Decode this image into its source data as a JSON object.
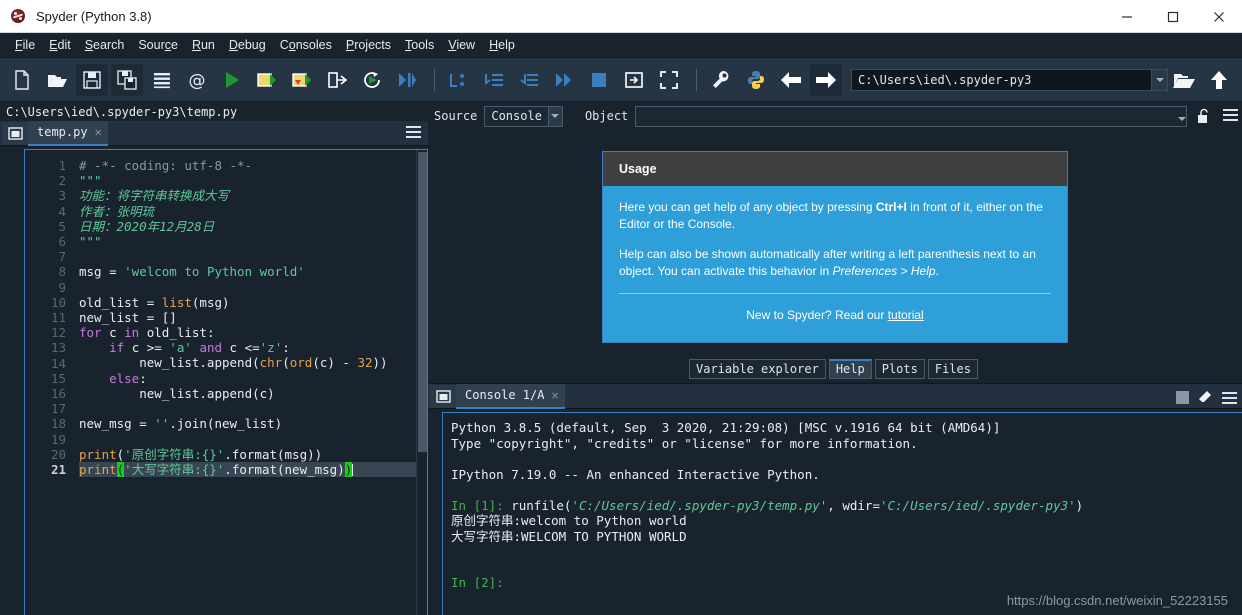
{
  "window": {
    "title": "Spyder (Python 3.8)",
    "app_icon": "spyder-logo-icon",
    "minimize": "–",
    "maximize": "□",
    "close": "✕"
  },
  "menubar": {
    "items": [
      {
        "label": "File",
        "accel": "F"
      },
      {
        "label": "Edit",
        "accel": "E"
      },
      {
        "label": "Search",
        "accel": "S"
      },
      {
        "label": "Source",
        "accel": "c"
      },
      {
        "label": "Run",
        "accel": "R"
      },
      {
        "label": "Debug",
        "accel": "D"
      },
      {
        "label": "Consoles",
        "accel": "o"
      },
      {
        "label": "Projects",
        "accel": "P"
      },
      {
        "label": "Tools",
        "accel": "T"
      },
      {
        "label": "View",
        "accel": "V"
      },
      {
        "label": "Help",
        "accel": "H"
      }
    ]
  },
  "toolbar": {
    "buttons": [
      "new-file-icon",
      "open-file-icon",
      "save-file-icon",
      "save-all-icon",
      "file-switcher-icon",
      "find-symbol-icon",
      "run-file-icon",
      "run-cell-icon",
      "run-cell-advance-icon",
      "run-selection-icon",
      "rerun-icon",
      "debug-file-icon",
      "debug-step-over-icon",
      "debug-step-into-icon",
      "debug-step-return-icon",
      "debug-continue-icon",
      "stop-debug-icon",
      "maximize-pane-icon",
      "fullscreen-icon",
      "preferences-icon",
      "pythonpath-manager-icon",
      "back-icon",
      "forward-icon"
    ],
    "path_value": "C:\\Users\\ied\\.spyder-py3",
    "browse_icon": "open-folder-icon",
    "parent_icon": "arrow-up-icon"
  },
  "editor": {
    "file_path": "C:\\Users\\ied\\.spyder-py3\\temp.py",
    "window_icon": "undock-window-icon",
    "options_icon": "hamburger-menu-icon",
    "tab": {
      "label": "temp.py",
      "close": "✕"
    },
    "current_line": 21,
    "line_count": 21,
    "code_lines": [
      {
        "n": 1,
        "html": "<span class=\"cm\"># -*- coding: utf-8 -*-</span>"
      },
      {
        "n": 2,
        "html": "<span class=\"doc\">\"\"\"</span>"
      },
      {
        "n": 3,
        "html": "<span class=\"doc\">功能：将字符串转换成大写</span>"
      },
      {
        "n": 4,
        "html": "<span class=\"doc\">作者：张明琉</span>"
      },
      {
        "n": 5,
        "html": "<span class=\"doc\">日期：2020年12月28日</span>"
      },
      {
        "n": 6,
        "html": "<span class=\"doc\">\"\"\"</span>"
      },
      {
        "n": 7,
        "html": ""
      },
      {
        "n": 8,
        "html": "msg = <span class=\"st\">'welcom to Python world'</span>"
      },
      {
        "n": 9,
        "html": ""
      },
      {
        "n": 10,
        "html": "old_list = <span class=\"bi\">list</span>(msg)"
      },
      {
        "n": 11,
        "html": "new_list = []"
      },
      {
        "n": 12,
        "html": "<span class=\"kw\">for</span> c <span class=\"kw\">in</span> old_list:"
      },
      {
        "n": 13,
        "html": "    <span class=\"kw\">if</span> c &gt;= <span class=\"st\">'a'</span> <span class=\"kw\">and</span> c &lt;=<span class=\"st\">'z'</span>:"
      },
      {
        "n": 14,
        "html": "        new_list.append(<span class=\"bi\">chr</span>(<span class=\"bi\">ord</span>(c) - <span class=\"num\">32</span>))"
      },
      {
        "n": 15,
        "html": "    <span class=\"kw\">else</span>:"
      },
      {
        "n": 16,
        "html": "        new_list.append(c)"
      },
      {
        "n": 17,
        "html": ""
      },
      {
        "n": 18,
        "html": "new_msg = <span class=\"st\">''</span>.join(new_list)"
      },
      {
        "n": 19,
        "html": ""
      },
      {
        "n": 20,
        "html": "<span class=\"bi\">print</span>(<span class=\"st\">'原创字符串:{}'</span>.format(msg))"
      },
      {
        "n": 21,
        "html": "<span class=\"bi\">print</span><span class=\"brk\">(</span><span class=\"st\">'大写字符串:{}'</span>.format(new_msg)<span class=\"brk\">)</span><span class=\"caret\"></span>"
      }
    ]
  },
  "help_panel": {
    "source_label": "Source",
    "source_value": "Console",
    "object_label": "Object",
    "object_value": "",
    "lock_icon": "unlocked-padlock-icon",
    "options_icon": "hamburger-menu-icon",
    "usage": {
      "title": "Usage",
      "paragraph1_pre": "Here you can get help of any object by pressing ",
      "paragraph1_key": "Ctrl+I",
      "paragraph1_post": " in front of it, either on the Editor or the Console.",
      "paragraph2_pre": "Help can also be shown automatically after writing a left parenthesis next to an object. You can activate this behavior in ",
      "paragraph2_em": "Preferences > Help",
      "paragraph2_post": ".",
      "footer_pre": "New to Spyder? Read our ",
      "footer_link": "tutorial"
    },
    "tabs": [
      {
        "label": "Variable explorer",
        "active": false
      },
      {
        "label": "Help",
        "active": true
      },
      {
        "label": "Plots",
        "active": false
      },
      {
        "label": "Files",
        "active": false
      }
    ]
  },
  "console": {
    "window_icon": "undock-window-icon",
    "tab": {
      "label": "Console 1/A",
      "close": "✕"
    },
    "stop_icon": "stop-square-icon",
    "clear_icon": "eraser-icon",
    "options_icon": "hamburger-menu-icon",
    "lines": [
      {
        "html": "Python 3.8.5 (default, Sep  3 2020, 21:29:08) [MSC v.1916 64 bit (AMD64)]"
      },
      {
        "html": "Type \"copyright\", \"credits\" or \"license\" for more information."
      },
      {
        "html": ""
      },
      {
        "html": "IPython 7.19.0 -- An enhanced Interactive Python."
      },
      {
        "html": ""
      },
      {
        "html": "<span class=\"in\">In [1]:</span> runfile(<span class=\"cstr\">'C:/Users/ied/.spyder-py3/temp.py'</span>, wdir=<span class=\"cstr\">'C:/Users/ied/.spyder-py3'</span>)"
      },
      {
        "html": "原创字符串:welcom to Python world"
      },
      {
        "html": "大写字符串:WELCOM TO PYTHON WORLD"
      },
      {
        "html": ""
      },
      {
        "html": ""
      },
      {
        "html": "<span class=\"in\">In [2]:</span>"
      }
    ]
  },
  "watermark": "https://blog.csdn.net/weixin_52223155",
  "colors": {
    "window_bg": "#19232d",
    "toolbar_bg": "#263544",
    "accent_blue": "#3c7ebf",
    "usage_blue": "#2e9fd8",
    "string_green": "#5ec89a",
    "keyword_purple": "#c678dd",
    "builtin_orange": "#e5a34b",
    "prompt_green": "#3cb44a"
  }
}
